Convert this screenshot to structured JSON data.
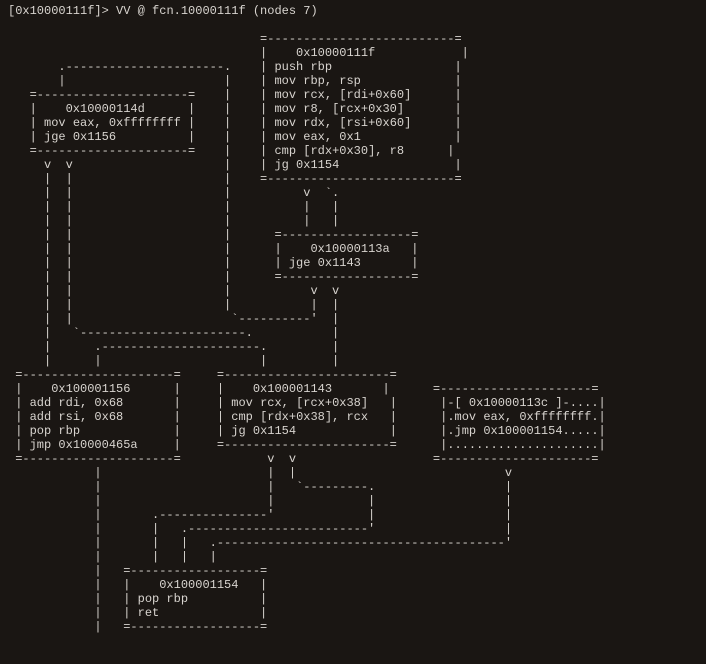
{
  "prompt": {
    "address": "[0x10000111f]> ",
    "command": "VV @ fcn.10000111f (nodes 7)"
  },
  "nodes": {
    "entry": {
      "addr": "0x10000111f",
      "ins": [
        "push rbp",
        "mov rbp, rsp",
        "mov rcx, [rdi+0x60]",
        "mov r8, [rcx+0x30]",
        "mov rdx, [rsi+0x60]",
        "mov eax, 0x1",
        "cmp [rdx+0x30], r8",
        "jg 0x1154"
      ]
    },
    "n114d": {
      "addr": "0x10000114d",
      "ins": [
        "mov eax, 0xffffffff",
        "jge 0x1156"
      ]
    },
    "n113a": {
      "addr": "0x10000113a",
      "ins": [
        "jge 0x1143"
      ]
    },
    "n1143": {
      "addr": "0x100001143",
      "ins": [
        "mov rcx, [rcx+0x38]",
        "cmp [rdx+0x38], rcx",
        "jg 0x1154"
      ]
    },
    "n113c": {
      "header": "-[ 0x10000113c ]-....",
      "ins": [
        ".mov eax, 0xffffffff.",
        ".jmp 0x100001154....."
      ],
      "footer": "....................."
    },
    "n1156": {
      "addr": "0x100001156",
      "ins": [
        "add rdi, 0x68",
        "add rsi, 0x68",
        "pop rbp",
        "jmp 0x10000465a"
      ]
    },
    "n1154": {
      "addr": "0x100001154",
      "ins": [
        "pop rbp",
        "ret"
      ]
    }
  }
}
